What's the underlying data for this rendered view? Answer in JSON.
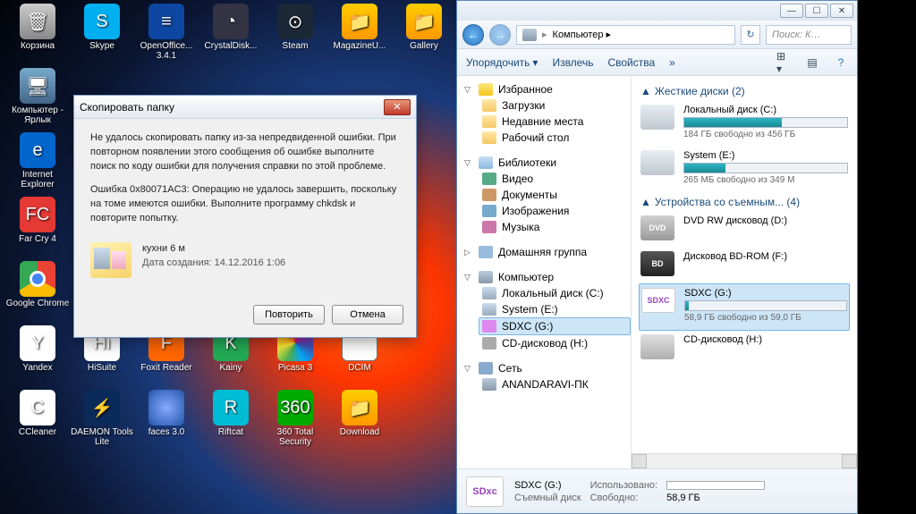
{
  "desktop": {
    "icons": [
      {
        "label": "Корзина",
        "cls": "ico-bin",
        "glyph": "🗑"
      },
      {
        "label": "Skype",
        "cls": "ico-skype",
        "glyph": "S"
      },
      {
        "label": "OpenOffice... 3.4.1",
        "cls": "ico-oo",
        "glyph": "≡"
      },
      {
        "label": "CrystalDisk...",
        "cls": "ico-cdi",
        "glyph": "◔"
      },
      {
        "label": "Steam",
        "cls": "ico-steam",
        "glyph": "⊙"
      },
      {
        "label": "MagazineU...",
        "cls": "ico-mag",
        "glyph": "📁"
      },
      {
        "label": "Gallery",
        "cls": "ico-gal",
        "glyph": "📁"
      },
      {
        "label": "Компьютер - Ярлык",
        "cls": "ico-comp",
        "glyph": "🖥"
      },
      {
        "label": "",
        "cls": "",
        "glyph": ""
      },
      {
        "label": "",
        "cls": "",
        "glyph": ""
      },
      {
        "label": "",
        "cls": "",
        "glyph": ""
      },
      {
        "label": "",
        "cls": "",
        "glyph": ""
      },
      {
        "label": "",
        "cls": "",
        "glyph": ""
      },
      {
        "label": "",
        "cls": "",
        "glyph": ""
      },
      {
        "label": "Internet Explorer",
        "cls": "ico-ie",
        "glyph": "e"
      },
      {
        "label": "",
        "cls": "",
        "glyph": ""
      },
      {
        "label": "",
        "cls": "",
        "glyph": ""
      },
      {
        "label": "",
        "cls": "",
        "glyph": ""
      },
      {
        "label": "",
        "cls": "",
        "glyph": ""
      },
      {
        "label": "",
        "cls": "",
        "glyph": ""
      },
      {
        "label": "",
        "cls": "",
        "glyph": ""
      },
      {
        "label": "Far Cry 4",
        "cls": "ico-fc4",
        "glyph": "FC"
      },
      {
        "label": "",
        "cls": "",
        "glyph": ""
      },
      {
        "label": "",
        "cls": "",
        "glyph": ""
      },
      {
        "label": "",
        "cls": "",
        "glyph": ""
      },
      {
        "label": "",
        "cls": "",
        "glyph": ""
      },
      {
        "label": "",
        "cls": "",
        "glyph": ""
      },
      {
        "label": "",
        "cls": "",
        "glyph": ""
      },
      {
        "label": "Google Chrome",
        "cls": "ico-chrome",
        "glyph": ""
      },
      {
        "label": "",
        "cls": "",
        "glyph": ""
      },
      {
        "label": "",
        "cls": "",
        "glyph": ""
      },
      {
        "label": "",
        "cls": "",
        "glyph": ""
      },
      {
        "label": "",
        "cls": "",
        "glyph": ""
      },
      {
        "label": "",
        "cls": "",
        "glyph": ""
      },
      {
        "label": "",
        "cls": "",
        "glyph": ""
      },
      {
        "label": "Yandex",
        "cls": "ico-yandex",
        "glyph": "Y"
      },
      {
        "label": "HiSuite",
        "cls": "ico-hi",
        "glyph": "Hi"
      },
      {
        "label": "Foxit Reader",
        "cls": "ico-foxit",
        "glyph": "F"
      },
      {
        "label": "Kainy",
        "cls": "ico-kainy",
        "glyph": "K"
      },
      {
        "label": "Picasa 3",
        "cls": "ico-picasa",
        "glyph": ""
      },
      {
        "label": "DCIM",
        "cls": "ico-dcim",
        "glyph": ""
      },
      {
        "label": "",
        "cls": "",
        "glyph": ""
      },
      {
        "label": "CCleaner",
        "cls": "ico-cc",
        "glyph": "C"
      },
      {
        "label": "DAEMON Tools Lite",
        "cls": "ico-daemon",
        "glyph": "⚡"
      },
      {
        "label": "faces 3.0",
        "cls": "ico-faces",
        "glyph": ""
      },
      {
        "label": "Riftcat",
        "cls": "ico-rc",
        "glyph": "R"
      },
      {
        "label": "360 Total Security",
        "cls": "ico-360",
        "glyph": "360"
      },
      {
        "label": "Download",
        "cls": "ico-dl",
        "glyph": "📁"
      }
    ]
  },
  "dialog": {
    "title": "Скопировать папку",
    "msg1": "Не удалось скопировать папку из-за непредвиденной ошибки. При повторном появлении этого сообщения об ошибке выполните поиск по коду ошибки для получения справки по этой проблеме.",
    "msg2": "Ошибка 0x80071AC3: Операцию не удалось завершить, поскольку на томе имеются ошибки. Выполните программу chkdsk и повторите попытку.",
    "folder_name": "кухни 6 м",
    "folder_date": "Дата создания: 14.12.2016 1:06",
    "retry": "Повторить",
    "cancel": "Отмена"
  },
  "explorer": {
    "address": "Компьютер  ▸",
    "search_placeholder": "Поиск: К…",
    "toolbar": {
      "organize": "Упорядочить",
      "extract": "Извлечь",
      "props": "Свойства"
    },
    "tree": {
      "favorites": "Избранное",
      "fav_items": [
        "Загрузки",
        "Недавние места",
        "Рабочий стол"
      ],
      "libraries": "Библиотеки",
      "lib_items": [
        "Видео",
        "Документы",
        "Изображения",
        "Музыка"
      ],
      "homegroup": "Домашняя группа",
      "computer": "Компьютер",
      "comp_items": [
        "Локальный диск (C:)",
        "System (E:)",
        "SDXC (G:)",
        "CD-дисковод (H:)"
      ],
      "network": "Сеть",
      "net_items": [
        "ANANDARAVI-ПК"
      ]
    },
    "content": {
      "hdd_head": "Жесткие диски (2)",
      "hdd": [
        {
          "name": "Локальный диск (C:)",
          "free": "184 ГБ свободно из 456 ГБ",
          "fill": 60
        },
        {
          "name": "System (E:)",
          "free": "265 МБ свободно из 349 М",
          "fill": 25
        }
      ],
      "rem_head": "Устройства со съемным... (4)",
      "rem": [
        {
          "name": "DVD RW дисковод (D:)",
          "cls": "drv-dvd",
          "txt": "DVD"
        },
        {
          "name": "Дисковод BD-ROM (F:)",
          "cls": "drv-bd",
          "txt": "BD"
        },
        {
          "name": "SDXC (G:)",
          "cls": "drv-sd",
          "txt": "SDXC",
          "free": "58,9 ГБ свободно из 59,0 ГБ",
          "fill": 2,
          "sel": true
        },
        {
          "name": "CD-дисковод (H:)",
          "cls": "drv-cd",
          "txt": ""
        }
      ]
    },
    "status": {
      "title": "SDXC (G:)",
      "type": "Съемный диск",
      "used_lbl": "Использовано:",
      "free_lbl": "Свободно:",
      "free_val": "58,9 ГБ"
    }
  }
}
